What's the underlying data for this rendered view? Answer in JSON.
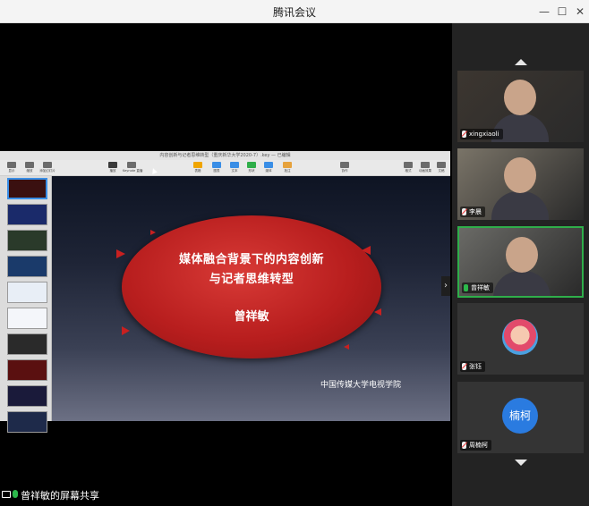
{
  "window": {
    "title": "腾讯会议",
    "minimize": "—",
    "maximize": "☐",
    "close": "✕"
  },
  "keynote": {
    "window_title": "内容创新与记者思维转型（重庆新华大学2020-7）.key — 已编辑",
    "toolbar": [
      {
        "label": "显示",
        "color": "#6c6c6c"
      },
      {
        "label": "缩放",
        "color": "#6c6c6c"
      },
      {
        "label": "添加幻灯片",
        "color": "#6c6c6c"
      },
      {
        "label": "播放",
        "color": "#3a3a3a"
      },
      {
        "label": "Keynote 直播",
        "color": "#6c6c6c"
      },
      {
        "label": "表格",
        "color": "#f0a500"
      },
      {
        "label": "图表",
        "color": "#3a8ee6"
      },
      {
        "label": "文本",
        "color": "#3a8ee6"
      },
      {
        "label": "形状",
        "color": "#2fae4a"
      },
      {
        "label": "媒体",
        "color": "#3a8ee6"
      },
      {
        "label": "批注",
        "color": "#e6a23c"
      },
      {
        "label": "协作",
        "color": "#6c6c6c"
      },
      {
        "label": "格式",
        "color": "#6c6c6c"
      },
      {
        "label": "动画效果",
        "color": "#6c6c6c"
      },
      {
        "label": "文稿",
        "color": "#6c6c6c"
      }
    ],
    "thumbnails": [
      {
        "num": "1",
        "bg": "#3a1010",
        "selected": true
      },
      {
        "num": "2",
        "bg": "#1a2a6a"
      },
      {
        "num": "3",
        "bg": "#2a3a2a"
      },
      {
        "num": "4",
        "bg": "#1a3a6a"
      },
      {
        "num": "5",
        "bg": "#e8eef6"
      },
      {
        "num": "6",
        "bg": "#f4f6fa"
      },
      {
        "num": "7",
        "bg": "#2a2a2a"
      },
      {
        "num": "8",
        "bg": "#5a1010"
      },
      {
        "num": "9",
        "bg": "#1a1a3a"
      },
      {
        "num": "10",
        "bg": "#1e2a4a"
      }
    ],
    "slide": {
      "title_line1": "媒体融合背景下的内容创新",
      "title_line2": "与记者思维转型",
      "author": "曾祥敏",
      "institution": "中国传媒大学电视学院"
    },
    "next_label": "›"
  },
  "share_status": "曾祥敏的屏幕共享",
  "participants": [
    {
      "name": "xingxiaoli",
      "type": "video",
      "mic": "muted",
      "bg": "#3c3630"
    },
    {
      "name": "李晨",
      "type": "video",
      "mic": "muted",
      "bg": "#7a7468"
    },
    {
      "name": "曾祥敏",
      "type": "video",
      "mic": "active",
      "bg": "#6a6a66",
      "speaking": true
    },
    {
      "name": "张钰",
      "type": "avatar",
      "mic": "muted",
      "avatar_color": "#f2f2f2"
    },
    {
      "name": "周楠柯",
      "type": "avatar",
      "mic": "muted",
      "avatar_color": "#2a7be0",
      "avatar_text": "楠柯"
    }
  ],
  "colors": {
    "speaking_border": "#2fae4a",
    "slide_red": "#b81e1e"
  }
}
